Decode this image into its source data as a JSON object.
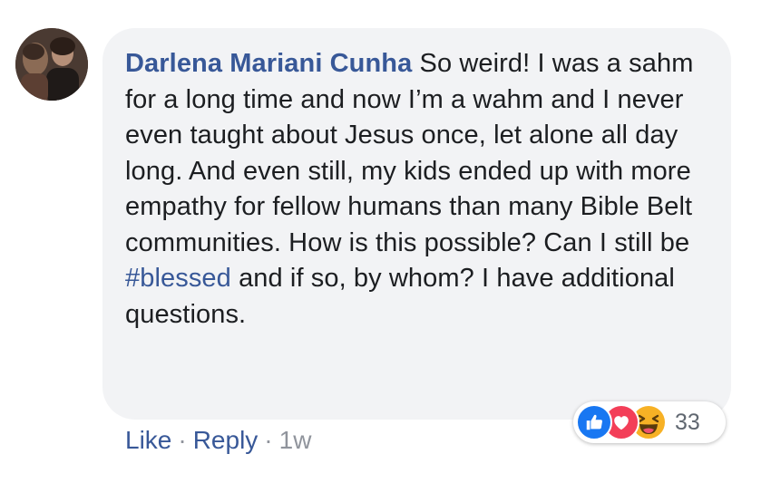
{
  "comment": {
    "author": "Darlena Mariani Cunha",
    "text_before_hashtag": "So weird! I was a sahm for a long time and now I’m a wahm and I never even taught about Jesus once, let alone all day long. And even still, my kids ended up with more empathy for fellow humans than many Bible Belt communities. How is this possible? Can I still be",
    "hashtag": "#blessed",
    "text_after_hashtag": "and if so, by whom? I have additional questions."
  },
  "reactions": {
    "icons": [
      "like-icon",
      "love-icon",
      "haha-icon"
    ],
    "count": "33"
  },
  "actions": {
    "like_label": "Like",
    "separator": "·",
    "reply_label": "Reply",
    "timestamp": "1w"
  },
  "colors": {
    "link": "#385898",
    "bubble": "#f2f3f5",
    "like": "#1877f2",
    "love": "#f33e58",
    "haha": "#f7b125"
  }
}
